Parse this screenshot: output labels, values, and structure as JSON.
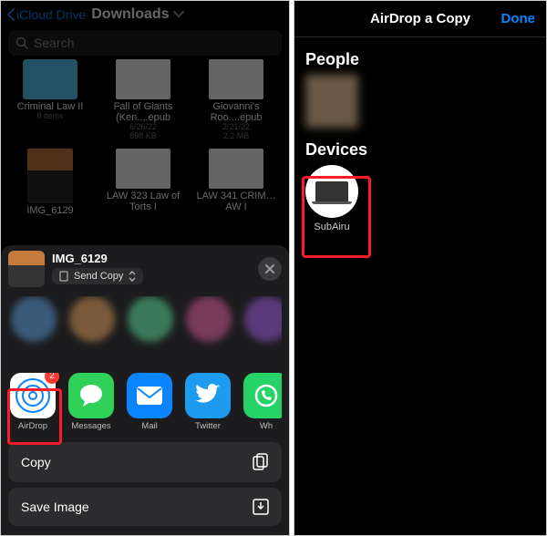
{
  "left": {
    "nav": {
      "back": "iCloud Drive",
      "title": "Downloads"
    },
    "search": {
      "placeholder": "Search"
    },
    "files": {
      "row1": [
        {
          "name": "Criminal Law II",
          "meta1": "8 items",
          "meta2": ""
        },
        {
          "name": "Fall of Giants (Ken....epub",
          "meta1": "6/26/22",
          "meta2": "898 KB"
        },
        {
          "name": "Giovanni's Roo....epub",
          "meta1": "2/21/22",
          "meta2": "2.2 MB"
        }
      ],
      "row2": [
        {
          "name": "IMG_6129",
          "meta1": "",
          "meta2": ""
        },
        {
          "name": "LAW 323 Law of Torts I",
          "meta1": "",
          "meta2": ""
        },
        {
          "name": "LAW 341 CRIM…AW I",
          "meta1": "",
          "meta2": ""
        }
      ]
    },
    "share": {
      "item_title": "IMG_6129",
      "mode": "Send Copy",
      "apps": {
        "airdrop": {
          "label": "AirDrop",
          "badge": "2"
        },
        "messages": {
          "label": "Messages"
        },
        "mail": {
          "label": "Mail"
        },
        "twitter": {
          "label": "Twitter"
        },
        "whatsapp": {
          "label": "Wh"
        }
      },
      "actions": {
        "copy": "Copy",
        "save_image": "Save Image"
      }
    }
  },
  "right": {
    "header": {
      "title": "AirDrop a Copy",
      "done": "Done"
    },
    "people_label": "People",
    "devices_label": "Devices",
    "device_name": "SubAiru"
  }
}
